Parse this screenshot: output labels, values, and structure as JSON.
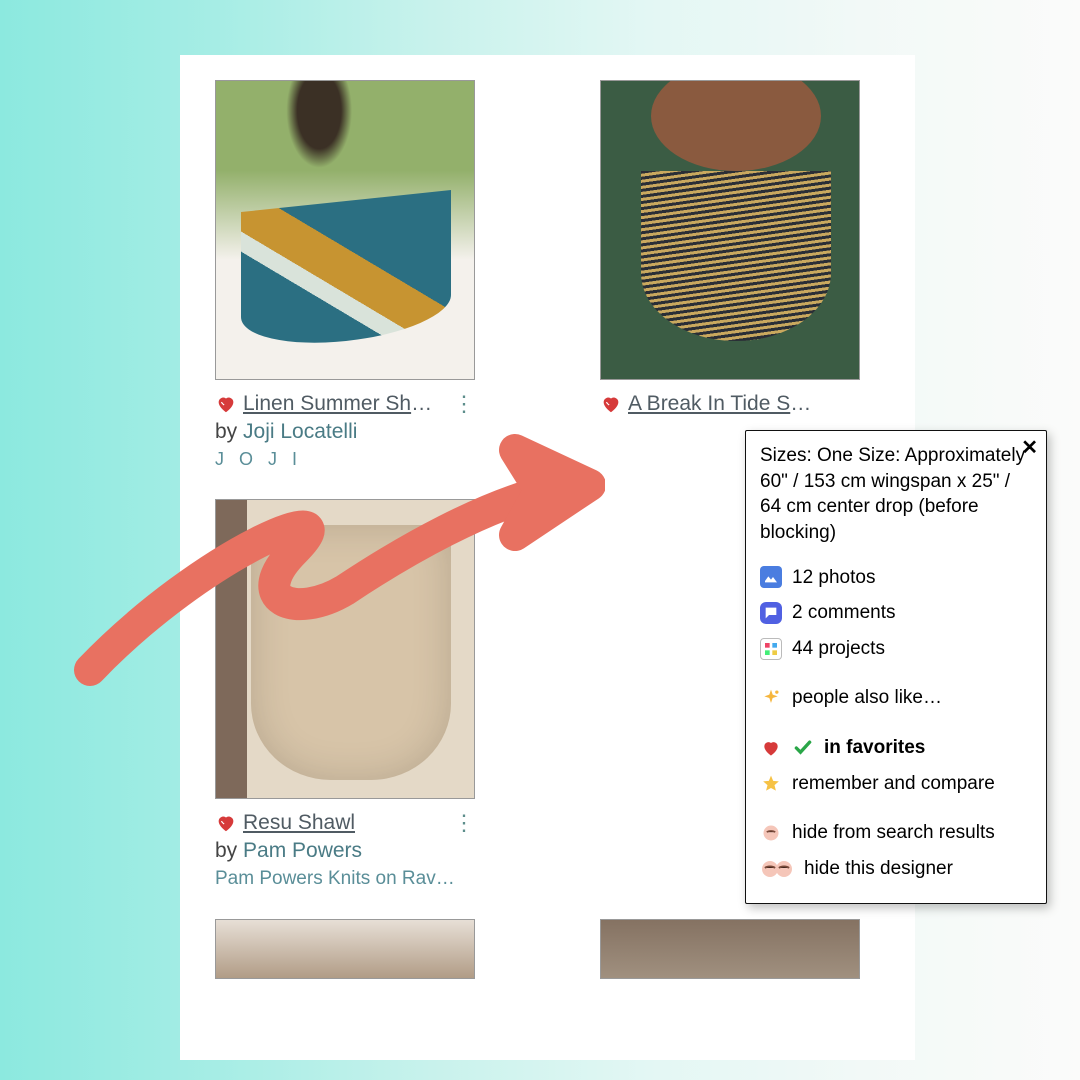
{
  "cards": [
    {
      "title": "Linen Summer Sha…",
      "by_prefix": "by ",
      "designer": "Joji Locatelli",
      "brand": "J O J I"
    },
    {
      "title": "A Break In Tide Sh…",
      "by_prefix": "",
      "designer": "",
      "brand": ""
    },
    {
      "title": "Resu Shawl",
      "by_prefix": "by ",
      "designer": "Pam Powers",
      "brand": "Pam Powers Knits on Rav…"
    }
  ],
  "popover": {
    "sizes": "Sizes: One Size: Approximately 60\" / 153 cm wingspan x 25\" / 64 cm center drop (before blocking)",
    "photos": "12 photos",
    "comments": "2 comments",
    "projects": "44 projects",
    "also_like": "people also like…",
    "in_favorites": "in favorites",
    "remember": "remember and compare",
    "hide_results": "hide from search results",
    "hide_designer": "hide this designer"
  }
}
